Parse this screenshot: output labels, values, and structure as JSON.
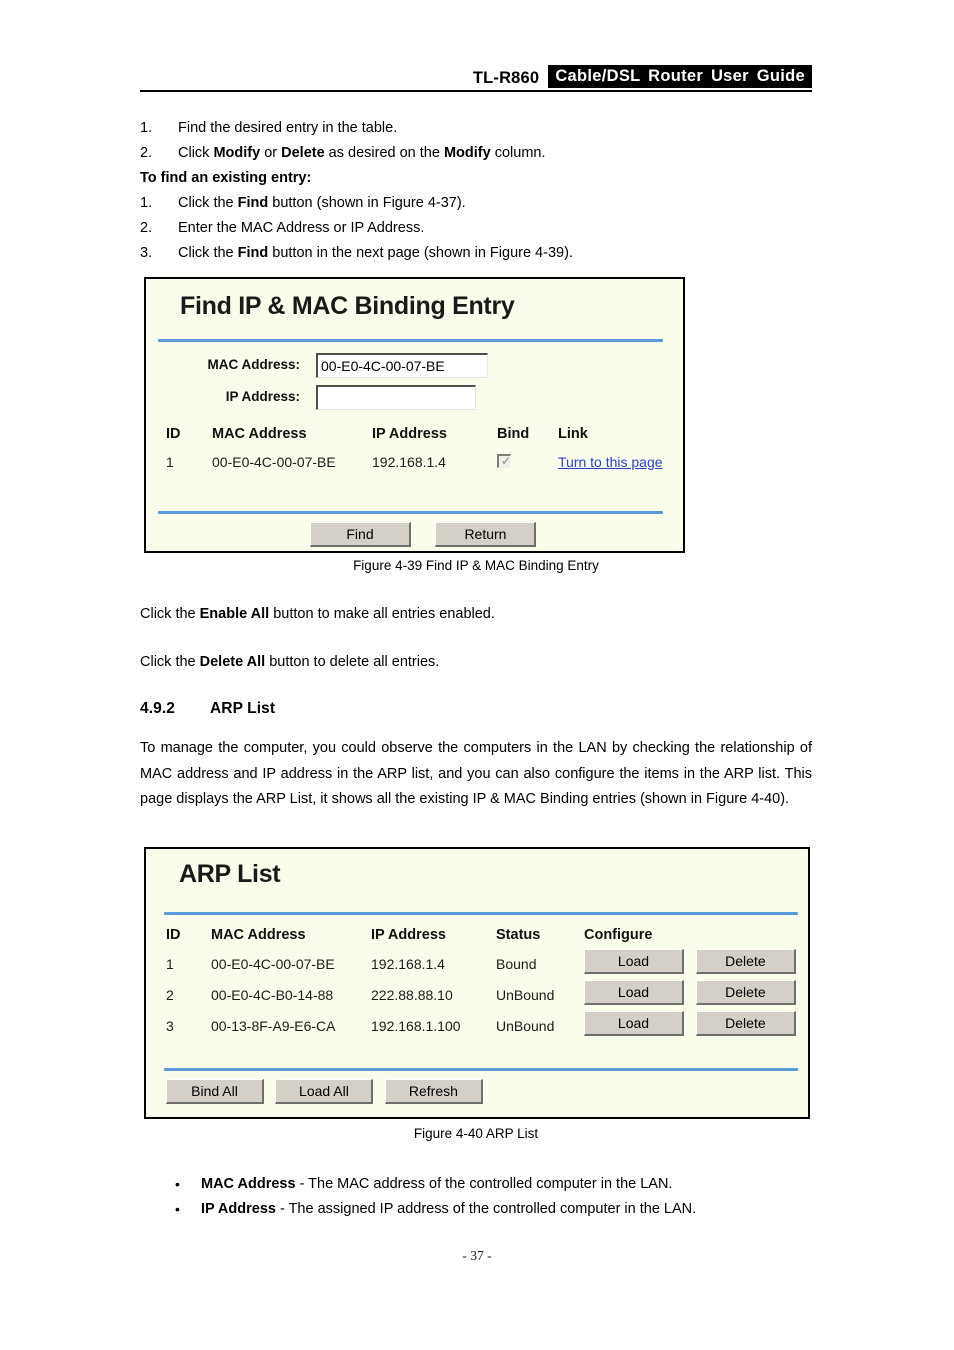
{
  "header": {
    "model": "TL-R860",
    "guide_title": "Cable/DSL  Router  User  Guide"
  },
  "top_list": [
    {
      "num": "1.",
      "text_parts": [
        {
          "t": "Find the desired entry in the table.",
          "b": false
        }
      ]
    },
    {
      "num": "2.",
      "text_parts": [
        {
          "t": "Click ",
          "b": false
        },
        {
          "t": "Modify",
          "b": true
        },
        {
          "t": " or ",
          "b": false
        },
        {
          "t": "Delete",
          "b": true
        },
        {
          "t": " as desired on the ",
          "b": false
        },
        {
          "t": "Modify",
          "b": true
        },
        {
          "t": " column.",
          "b": false
        }
      ]
    }
  ],
  "find_entry_heading": "To find an existing entry:",
  "find_entry_list": [
    {
      "num": "1.",
      "text_parts": [
        {
          "t": "Click the ",
          "b": false
        },
        {
          "t": "Find",
          "b": true
        },
        {
          "t": " button (shown in Figure 4-37).",
          "b": false
        }
      ]
    },
    {
      "num": "2.",
      "text_parts": [
        {
          "t": "Enter the MAC Address or IP Address.",
          "b": false
        }
      ]
    },
    {
      "num": "3.",
      "text_parts": [
        {
          "t": "Click the ",
          "b": false
        },
        {
          "t": "Find",
          "b": true
        },
        {
          "t": " button in the next page (shown in Figure 4-39).",
          "b": false
        }
      ]
    }
  ],
  "figure_find": {
    "title": "Find IP & MAC Binding Entry",
    "mac_label": "MAC Address:",
    "mac_value": "00-E0-4C-00-07-BE",
    "ip_label": "IP Address:",
    "ip_value": "",
    "columns": [
      "ID",
      "MAC Address",
      "IP Address",
      "Bind",
      "Link"
    ],
    "rows": [
      {
        "id": "1",
        "mac": "00-E0-4C-00-07-BE",
        "ip": "192.168.1.4",
        "bind_checked": true,
        "link_text": "Turn to this page"
      }
    ],
    "buttons": [
      "Find",
      "Return"
    ],
    "caption": "Figure 4-39    Find IP & MAC Binding Entry",
    "accent_color": "#5b9bd5",
    "background_color": "#fbfdec",
    "link_color": "#2b43c8"
  },
  "mid_paragraphs": [
    [
      {
        "t": "Click the ",
        "b": false
      },
      {
        "t": "Enable All",
        "b": true
      },
      {
        "t": " button to make all entries enabled.",
        "b": false
      }
    ],
    [
      {
        "t": "Click the ",
        "b": false
      },
      {
        "t": "Delete All",
        "b": true
      },
      {
        "t": " button to delete all entries.",
        "b": false
      }
    ]
  ],
  "section": {
    "number": "4.9.2",
    "title": "ARP List",
    "paragraph": "To manage the computer, you could observe the computers in the LAN by checking the relationship of MAC address and IP address in the ARP list, and you can also configure the items in the ARP list. This page displays the ARP List, it shows all the existing IP & MAC Binding entries (shown in Figure 4-40)."
  },
  "figure_arp": {
    "title": "ARP List",
    "columns": [
      "ID",
      "MAC Address",
      "IP Address",
      "Status",
      "Configure"
    ],
    "rows": [
      {
        "id": "1",
        "mac": "00-E0-4C-00-07-BE",
        "ip": "192.168.1.4",
        "status": "Bound",
        "load_label": "Load",
        "delete_label": "Delete"
      },
      {
        "id": "2",
        "mac": "00-E0-4C-B0-14-88",
        "ip": "222.88.88.10",
        "status": "UnBound",
        "load_label": "Load",
        "delete_label": "Delete"
      },
      {
        "id": "3",
        "mac": "00-13-8F-A9-E6-CA",
        "ip": "192.168.1.100",
        "status": "UnBound",
        "load_label": "Load",
        "delete_label": "Delete"
      }
    ],
    "footer_buttons": [
      "Bind All",
      "Load All",
      "Refresh"
    ],
    "caption": "Figure 4-40 ARP List",
    "accent_color": "#5b9bd5",
    "background_color": "#fbfdec"
  },
  "bullets": [
    {
      "term": "MAC Address",
      "desc": " - The MAC address of the controlled computer in the LAN."
    },
    {
      "term": "IP Address",
      "desc": " - The assigned IP address of the controlled computer in the LAN."
    }
  ],
  "footer": {
    "page_number": "- 37 -"
  }
}
